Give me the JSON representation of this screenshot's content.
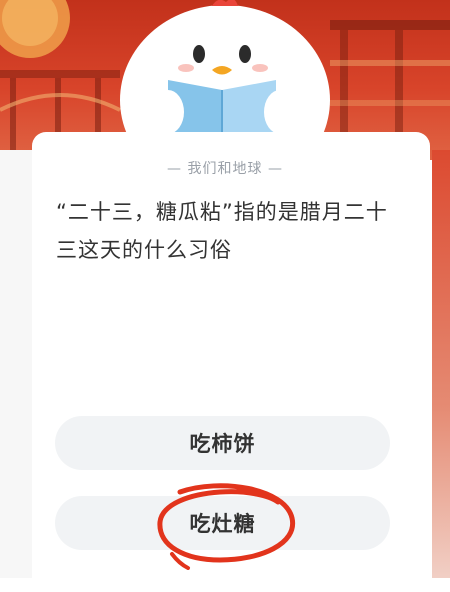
{
  "quiz": {
    "category": "— 我们和地球 —",
    "question": "“二十三，糖瓜粘”指的是腊月二十三这天的什么习俗",
    "options": [
      {
        "label": "吃柿饼"
      },
      {
        "label": "吃灶糖"
      }
    ]
  },
  "colors": {
    "banner": "#c2311b",
    "annotation": "#e2341c",
    "option_bg": "#f1f3f5",
    "text": "#333333",
    "category_text": "#9aa0a8"
  }
}
